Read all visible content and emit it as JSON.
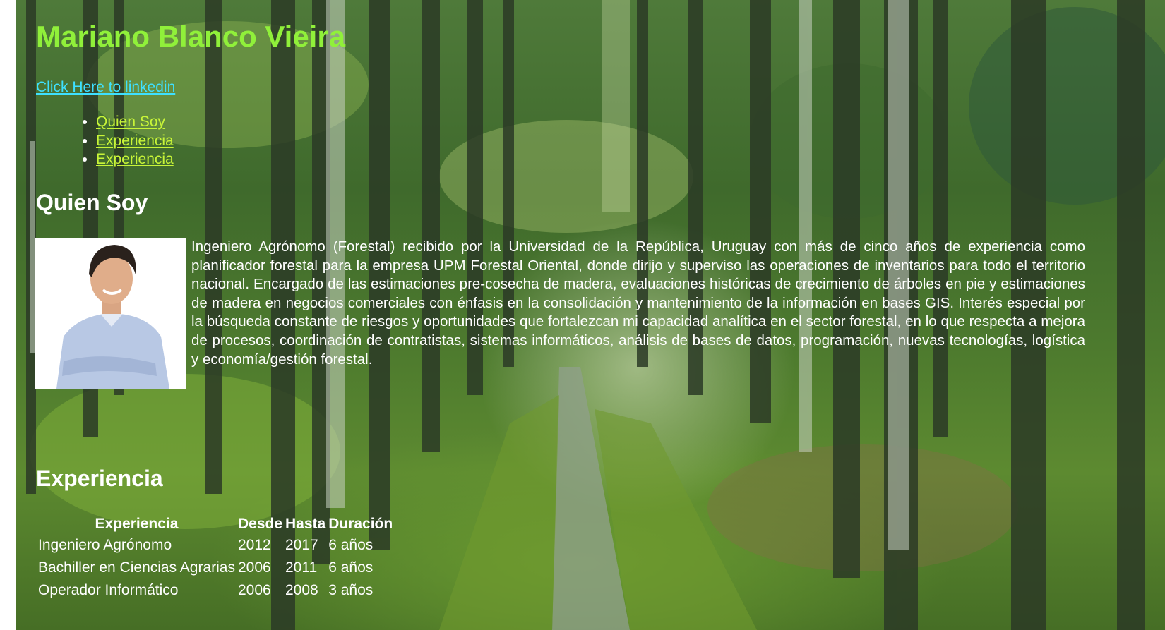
{
  "profile": {
    "name": "Mariano Blanco Vieira",
    "linkedin_label": "Click Here to linkedin"
  },
  "nav": {
    "items": [
      {
        "label": "Quien Soy"
      },
      {
        "label": "Experiencia"
      },
      {
        "label": "Experiencia"
      }
    ]
  },
  "about": {
    "title": "Quien Soy",
    "text": "Ingeniero Agrónomo (Forestal) recibido por la Universidad de la República, Uruguay con más de cinco años de experiencia como planificador forestal para la empresa UPM Forestal Oriental, donde dirijo y superviso las operaciones de inventarios para todo el territorio nacional. Encargado de las estimaciones pre-cosecha de madera, evaluaciones históricas de crecimiento de árboles en pie y estimaciones de madera en negocios comerciales con énfasis en la consolidación y mantenimiento de la información en bases GIS. Interés especial por la búsqueda constante de riesgos y oportunidades que fortalezcan mi capacidad analítica en el sector forestal, en lo que respecta a mejora de procesos, coordinación de contratistas, sistemas informáticos, análisis de bases de datos, programación, nuevas tecnologías, logística y economía/gestión forestal."
  },
  "experience": {
    "title": "Experiencia",
    "headers": {
      "role": "Experiencia",
      "from": "Desde",
      "to": "Hasta",
      "duration": "Duración"
    },
    "rows": [
      {
        "role": "Ingeniero Agrónomo",
        "from": "2012",
        "to": "2017",
        "duration": "6 años"
      },
      {
        "role": "Bachiller en Ciencias Agrarias",
        "from": "2006",
        "to": "2011",
        "duration": "6 años"
      },
      {
        "role": "Operador Informático",
        "from": "2006",
        "to": "2008",
        "duration": "3 años"
      }
    ]
  },
  "colors": {
    "name": "#90f03a",
    "linkedin": "#3ee0ff",
    "nav_link": "#c8f538",
    "text": "#ffffff"
  }
}
